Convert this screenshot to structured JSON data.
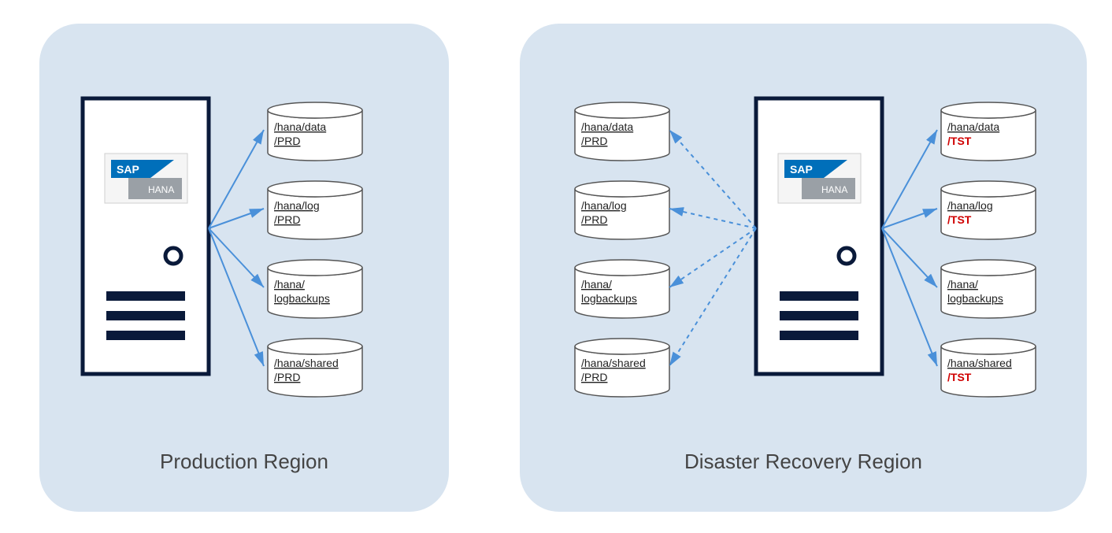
{
  "regions": {
    "production": {
      "label": "Production Region",
      "server_logo": "SAP HANA",
      "disks": [
        {
          "line1": "/hana/data",
          "line2": "/PRD",
          "line2_red": false
        },
        {
          "line1": "/hana/log",
          "line2": "/PRD",
          "line2_red": false
        },
        {
          "line1": "/hana/",
          "line2": "logbackups",
          "line2_red": false
        },
        {
          "line1": "/hana/shared",
          "line2": "/PRD",
          "line2_red": false
        }
      ]
    },
    "dr": {
      "label": "Disaster Recovery Region",
      "server_logo": "SAP HANA",
      "left_disks": [
        {
          "line1": "/hana/data",
          "line2": "/PRD"
        },
        {
          "line1": "/hana/log",
          "line2": "/PRD"
        },
        {
          "line1": "/hana/",
          "line2": "logbackups"
        },
        {
          "line1": "/hana/shared",
          "line2": "/PRD"
        }
      ],
      "right_disks": [
        {
          "line1": "/hana/data",
          "line2": "/TST",
          "line2_red": true
        },
        {
          "line1": "/hana/log",
          "line2": "/TST",
          "line2_red": true
        },
        {
          "line1": "/hana/",
          "line2": "logbackups",
          "line2_red": false
        },
        {
          "line1": "/hana/shared",
          "line2": "/TST",
          "line2_red": true
        }
      ]
    }
  },
  "colors": {
    "region_bg": "#d8e4f0",
    "arrow_solid": "#4a90d9",
    "arrow_dashed": "#4a90d9",
    "server_stroke": "#0a1a3a",
    "sap_blue": "#006fba",
    "sap_gray": "#9aa0a6"
  }
}
